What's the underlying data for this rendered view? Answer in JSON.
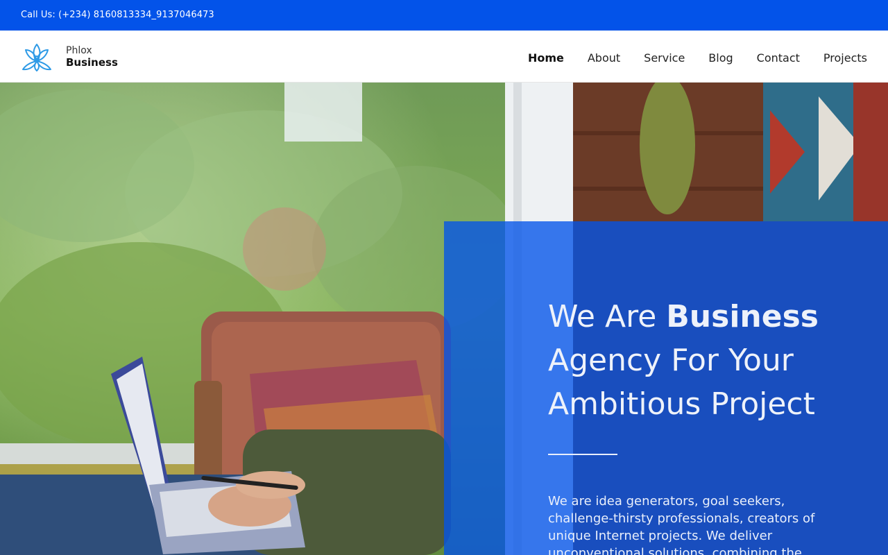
{
  "topbar": {
    "phone_text": "Call Us: (+234) 8160813334_9137046473"
  },
  "brand": {
    "line1": "Phlox",
    "line2": "Business",
    "logo_icon": "lotus-icon"
  },
  "nav": {
    "items": [
      {
        "label": "Home",
        "active": true
      },
      {
        "label": "About"
      },
      {
        "label": "Service"
      },
      {
        "label": "Blog"
      },
      {
        "label": "Contact"
      },
      {
        "label": "Projects"
      }
    ]
  },
  "hero": {
    "headline_pre": "We Are ",
    "headline_bold": "Business",
    "headline_post": "Agency For Your Ambitious Project",
    "description": "We are idea generators, goal seekers, challenge-thirsty professionals, creators of unique Internet projects. We deliver unconventional solutions, combining the most advanced web technologies",
    "overlay_color": "#0353e9"
  },
  "colors": {
    "brand_blue": "#0353e9",
    "logo_blue": "#2e9ae6"
  }
}
